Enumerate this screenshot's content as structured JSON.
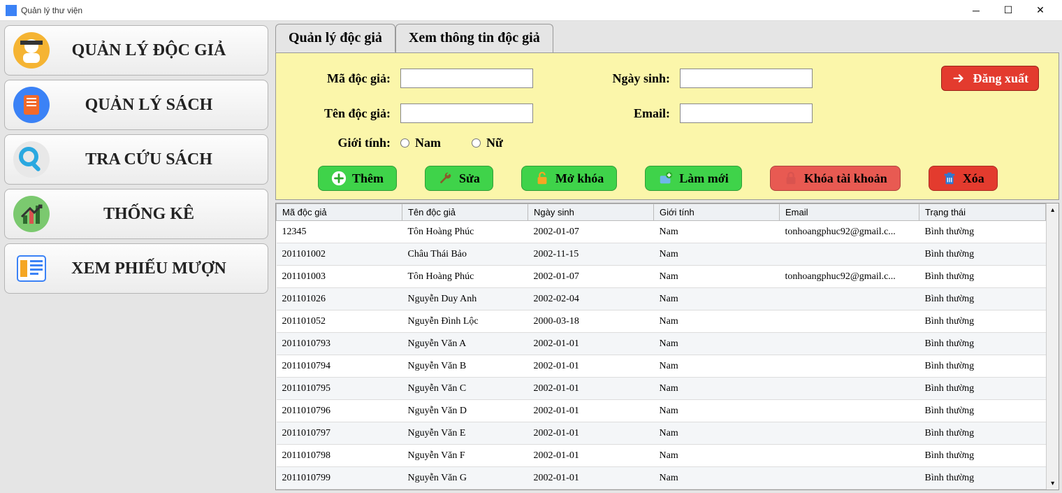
{
  "window": {
    "title": "Quản lý thư viện"
  },
  "sidebar": {
    "items": [
      {
        "id": "readers",
        "label": "QUẢN LÝ ĐỘC GIẢ"
      },
      {
        "id": "books",
        "label": "QUẢN LÝ SÁCH"
      },
      {
        "id": "search",
        "label": "TRA CỨU SÁCH"
      },
      {
        "id": "stats",
        "label": "THỐNG KÊ"
      },
      {
        "id": "loan",
        "label": "XEM PHIẾU MƯỢN"
      }
    ]
  },
  "tabs": [
    {
      "id": "manage",
      "label": "Quản lý độc giả",
      "active": true
    },
    {
      "id": "view",
      "label": "Xem thông tin độc giả",
      "active": false
    }
  ],
  "form": {
    "labels": {
      "reader_id": "Mã độc giả:",
      "reader_name": "Tên độc giả:",
      "gender": "Giới tính:",
      "dob": "Ngày sinh:",
      "email": "Email:",
      "gender_male": "Nam",
      "gender_female": "Nữ"
    },
    "values": {
      "reader_id": "",
      "reader_name": "",
      "dob": "",
      "email": ""
    }
  },
  "actions": {
    "logout": "Đăng xuất",
    "add": "Thêm",
    "edit": "Sửa",
    "unlock": "Mở khóa",
    "refresh": "Làm mới",
    "lock": "Khóa tài khoản",
    "delete": "Xóa"
  },
  "table": {
    "columns": [
      "Mã độc giả",
      "Tên độc giả",
      "Ngày sinh",
      "Giới tính",
      "Email",
      "Trạng thái"
    ],
    "rows": [
      [
        "12345",
        "Tôn Hoàng Phúc",
        "2002-01-07",
        "Nam",
        "tonhoangphuc92@gmail.c...",
        "Bình thường"
      ],
      [
        "201101002",
        "Châu Thái Bảo",
        "2002-11-15",
        "Nam",
        "",
        "Bình thường"
      ],
      [
        "201101003",
        "Tôn Hoàng Phúc",
        "2002-01-07",
        "Nam",
        "tonhoangphuc92@gmail.c...",
        "Bình thường"
      ],
      [
        "201101026",
        "Nguyễn Duy Anh",
        "2002-02-04",
        "Nam",
        "",
        "Bình thường"
      ],
      [
        "201101052",
        "Nguyễn Đình Lộc",
        "2000-03-18",
        "Nam",
        "",
        "Bình thường"
      ],
      [
        "2011010793",
        "Nguyễn Văn A",
        "2002-01-01",
        "Nam",
        "",
        "Bình thường"
      ],
      [
        "2011010794",
        "Nguyễn Văn B",
        "2002-01-01",
        "Nam",
        "",
        "Bình thường"
      ],
      [
        "2011010795",
        "Nguyễn Văn C",
        "2002-01-01",
        "Nam",
        "",
        "Bình thường"
      ],
      [
        "2011010796",
        "Nguyễn Văn D",
        "2002-01-01",
        "Nam",
        "",
        "Bình thường"
      ],
      [
        "2011010797",
        "Nguyễn Văn E",
        "2002-01-01",
        "Nam",
        "",
        "Bình thường"
      ],
      [
        "2011010798",
        "Nguyễn Văn F",
        "2002-01-01",
        "Nam",
        "",
        "Bình thường"
      ],
      [
        "2011010799",
        "Nguyễn Văn G",
        "2002-01-01",
        "Nam",
        "",
        "Bình thường"
      ]
    ]
  }
}
